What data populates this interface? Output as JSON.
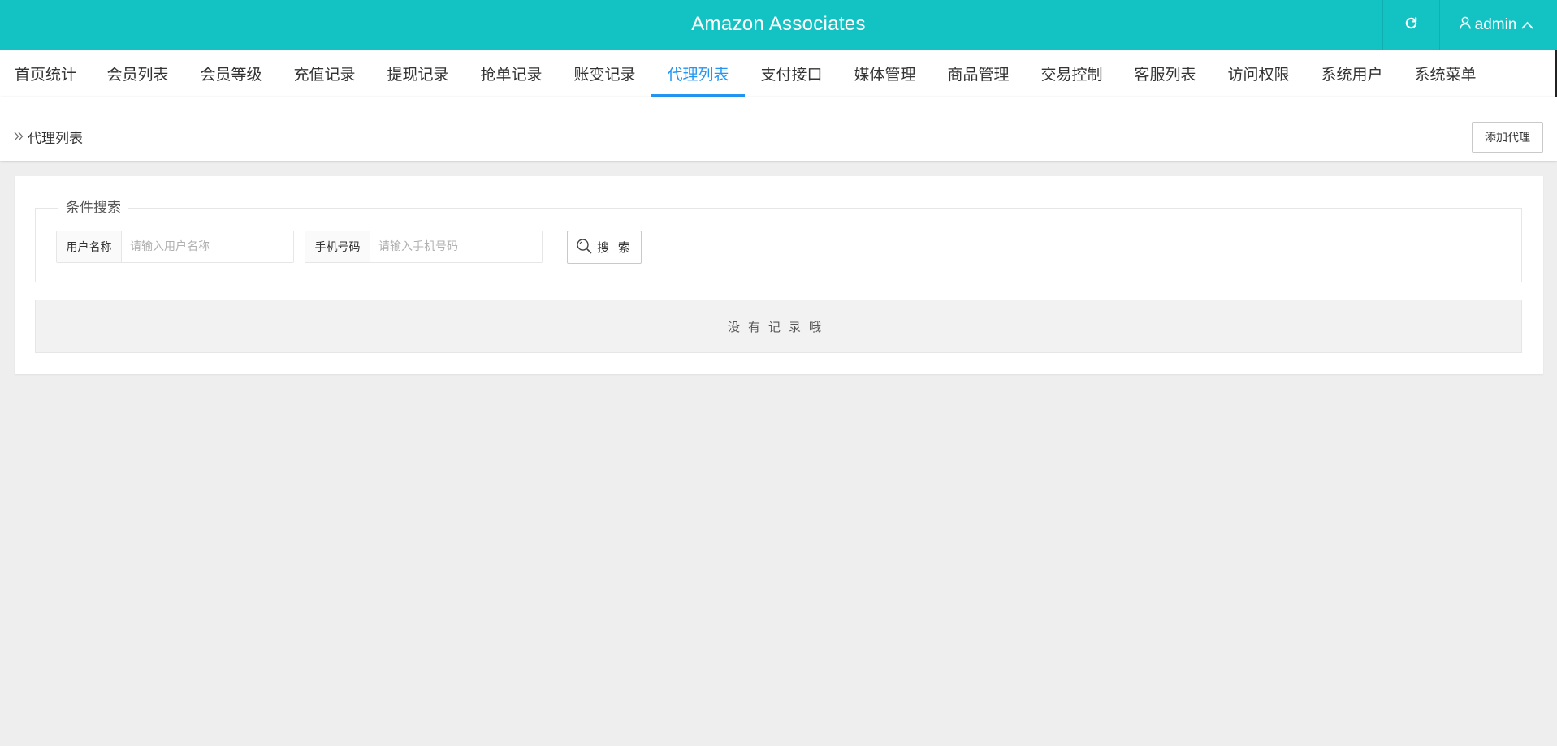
{
  "header": {
    "title": "Amazon Associates",
    "refresh_icon": "refresh-icon",
    "user": {
      "name": "admin",
      "icon": "user-icon",
      "chevron": "chevron-up-icon"
    }
  },
  "nav": {
    "active_index": 7,
    "active_color": "#2196f3",
    "items": [
      {
        "label": "首页统计"
      },
      {
        "label": "会员列表"
      },
      {
        "label": "会员等级"
      },
      {
        "label": "充值记录"
      },
      {
        "label": "提现记录"
      },
      {
        "label": "抢单记录"
      },
      {
        "label": "账变记录"
      },
      {
        "label": "代理列表"
      },
      {
        "label": "支付接口"
      },
      {
        "label": "媒体管理"
      },
      {
        "label": "商品管理"
      },
      {
        "label": "交易控制"
      },
      {
        "label": "客服列表"
      },
      {
        "label": "访问权限"
      },
      {
        "label": "系统用户"
      },
      {
        "label": "系统菜单"
      }
    ]
  },
  "breadcrumb": {
    "icon": "double-chevron-right-icon",
    "label": "代理列表"
  },
  "toolbar": {
    "add_label": "添加代理"
  },
  "search": {
    "legend": "条件搜索",
    "username": {
      "label": "用户名称",
      "placeholder": "请输入用户名称",
      "value": ""
    },
    "phone": {
      "label": "手机号码",
      "placeholder": "请输入手机号码",
      "value": ""
    },
    "button_label": "搜 索",
    "button_icon": "search-icon"
  },
  "table": {
    "empty_text": "没有记录哦"
  },
  "colors": {
    "brand": "#13c3c4",
    "background": "#eeeeee"
  }
}
